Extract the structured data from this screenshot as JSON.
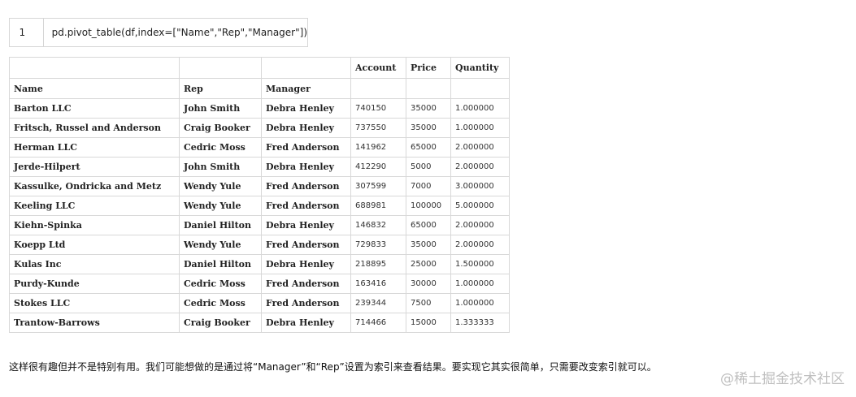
{
  "code_cell": {
    "line_number": "1",
    "code": "pd.pivot_table(df,index=[\"Name\",\"Rep\",\"Manager\"])"
  },
  "table": {
    "header_top": [
      "",
      "",
      "",
      "Account",
      "Price",
      "Quantity"
    ],
    "header_index": [
      "Name",
      "Rep",
      "Manager",
      "",
      "",
      ""
    ],
    "rows": [
      [
        "Barton LLC",
        "John Smith",
        "Debra Henley",
        "740150",
        "35000",
        "1.000000"
      ],
      [
        "Fritsch, Russel and Anderson",
        "Craig Booker",
        "Debra Henley",
        "737550",
        "35000",
        "1.000000"
      ],
      [
        "Herman LLC",
        "Cedric Moss",
        "Fred Anderson",
        "141962",
        "65000",
        "2.000000"
      ],
      [
        "Jerde-Hilpert",
        "John Smith",
        "Debra Henley",
        "412290",
        "5000",
        "2.000000"
      ],
      [
        "Kassulke, Ondricka and Metz",
        "Wendy Yule",
        "Fred Anderson",
        "307599",
        "7000",
        "3.000000"
      ],
      [
        "Keeling LLC",
        "Wendy Yule",
        "Fred Anderson",
        "688981",
        "100000",
        "5.000000"
      ],
      [
        "Kiehn-Spinka",
        "Daniel Hilton",
        "Debra Henley",
        "146832",
        "65000",
        "2.000000"
      ],
      [
        "Koepp Ltd",
        "Wendy Yule",
        "Fred Anderson",
        "729833",
        "35000",
        "2.000000"
      ],
      [
        "Kulas Inc",
        "Daniel Hilton",
        "Debra Henley",
        "218895",
        "25000",
        "1.500000"
      ],
      [
        "Purdy-Kunde",
        "Cedric Moss",
        "Fred Anderson",
        "163416",
        "30000",
        "1.000000"
      ],
      [
        "Stokes LLC",
        "Cedric Moss",
        "Fred Anderson",
        "239344",
        "7500",
        "1.000000"
      ],
      [
        "Trantow-Barrows",
        "Craig Booker",
        "Debra Henley",
        "714466",
        "15000",
        "1.333333"
      ]
    ]
  },
  "caption": "这样很有趣但并不是特别有用。我们可能想做的是通过将“Manager”和“Rep”设置为索引来查看结果。要实现它其实很简单，只需要改变索引就可以。",
  "watermark": "@稀土掘金技术社区"
}
